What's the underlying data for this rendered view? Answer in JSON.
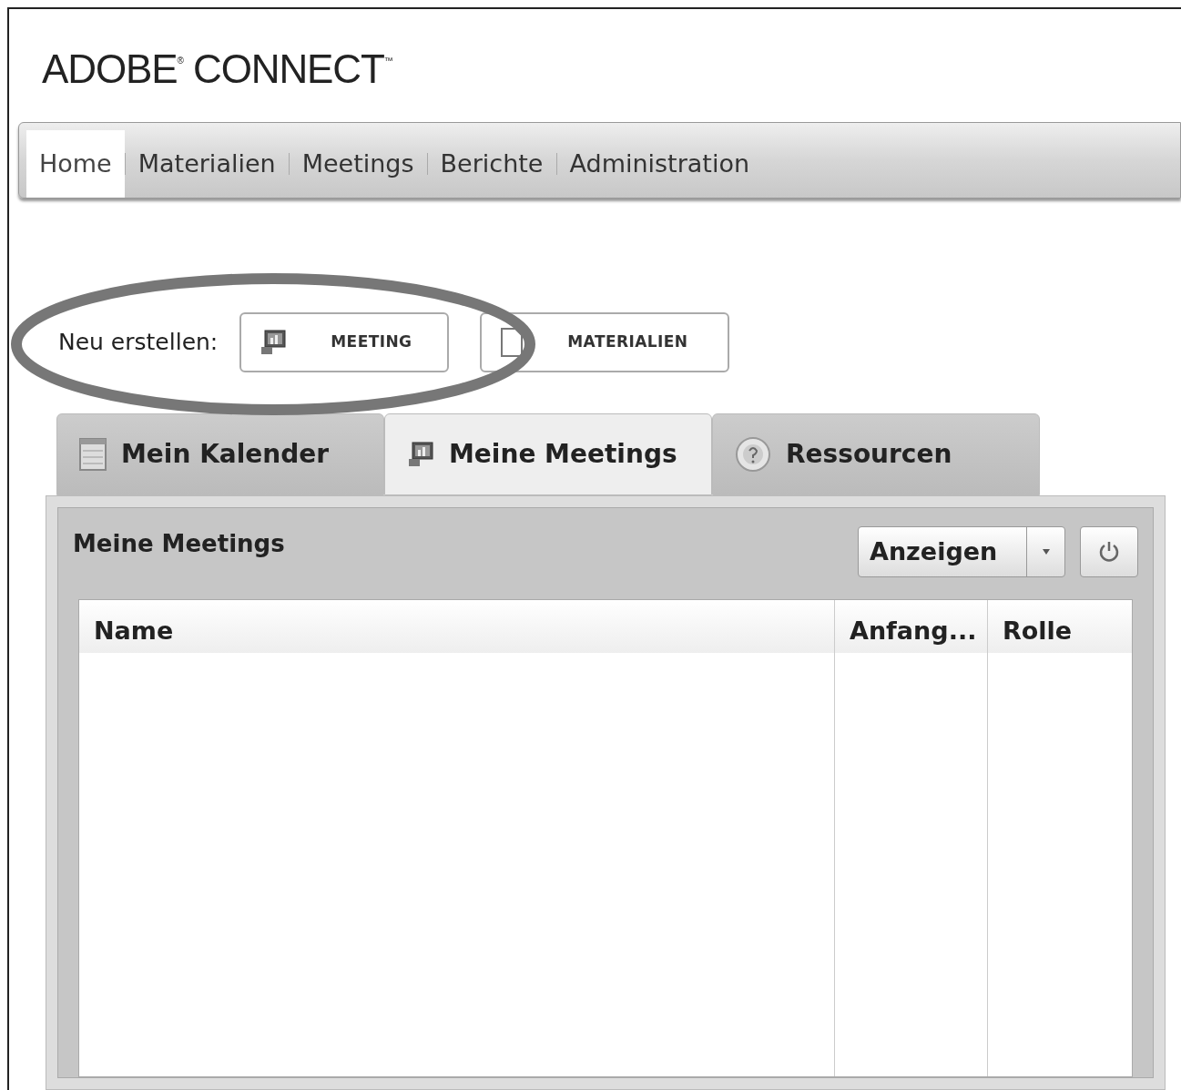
{
  "logo": "ADOBE$^{®}$ CONNECT$^{™}$",
  "nav": [
    {
      "label": "Home",
      "selected": true
    },
    {
      "label": "Materialien",
      "selected": false
    },
    {
      "label": "Meetings",
      "selected": false
    },
    {
      "label": "Berichte",
      "selected": false
    },
    {
      "label": "Administration",
      "selected": false
    }
  ],
  "create": {
    "label": "Neu erstellen:",
    "buttons": [
      {
        "label": "MEETING",
        "kind": "meeting"
      },
      {
        "label": "MATERIALIEN",
        "kind": "document"
      }
    ]
  },
  "tabs": [
    {
      "label": "Mein Kalender",
      "kind": "calendar",
      "selected": false
    },
    {
      "label": "Meine Meetings",
      "kind": "meeting",
      "selected": true
    },
    {
      "label": "Ressourcen",
      "kind": "help",
      "selected": false
    }
  ],
  "panel": {
    "title": "Meine Meetings",
    "view_select": "Anzeigen",
    "columns": [
      "Name",
      "Anfang...",
      "Rolle"
    ]
  }
}
